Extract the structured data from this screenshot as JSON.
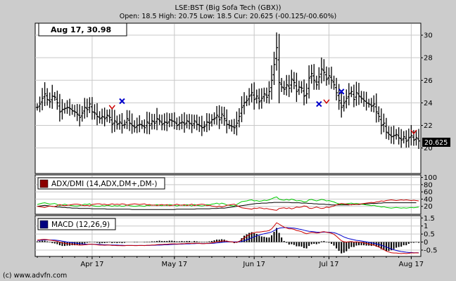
{
  "header": {
    "title": "LSE:BST (Big Sofa Tech (GBX))",
    "quote": "Open: 18.5 High: 20.75 Low: 18.5 Cur: 20.625 (-00.125/-00.60%)"
  },
  "date_box": "Aug 17, 30.98",
  "last_price_label": "20.625",
  "copyright": "(c) www.advfn.com",
  "colors": {
    "background": "#cccccc",
    "panel": "#ffffff",
    "grid": "#c8c8c8",
    "adx": "#000000",
    "dmi_plus": "#00cc00",
    "dmi_minus": "#cc0000",
    "macd": "#cc0000",
    "signal": "#0000cc",
    "histogram": "#000000",
    "price_bars": "#000000",
    "buy_marker": "#0000cc",
    "sell_marker": "#cc0000",
    "adx_legend": "#8b0000",
    "macd_legend": "#000080"
  },
  "chart_data": [
    {
      "type": "ohlc",
      "title": "LSE:BST (Big Sofa Tech (GBX))",
      "x_ticks": [
        "Apr 17",
        "May 17",
        "Jun 17",
        "Jul 17",
        "Aug 17"
      ],
      "y_ticks": [
        20,
        22,
        24,
        26,
        28,
        30
      ],
      "ylim": [
        17.8,
        31.0
      ],
      "grid": true,
      "last_price": 20.625,
      "close": [
        23.6,
        23.9,
        24.4,
        24.8,
        24.3,
        24.1,
        24.6,
        24.5,
        24.0,
        23.2,
        23.4,
        23.5,
        23.6,
        23.5,
        23.3,
        23.2,
        23.0,
        22.7,
        23.1,
        23.6,
        23.4,
        23.9,
        23.2,
        23.1,
        22.8,
        22.6,
        22.8,
        22.6,
        22.9,
        22.7,
        22.1,
        22.4,
        22.1,
        22.3,
        22.0,
        22.1,
        22.6,
        22.2,
        22.0,
        21.8,
        22.0,
        22.1,
        22.0,
        21.8,
        22.3,
        22.0,
        22.4,
        22.2,
        22.6,
        22.4,
        22.1,
        22.3,
        22.2,
        22.5,
        22.4,
        22.3,
        22.0,
        22.2,
        22.3,
        22.1,
        22.4,
        22.2,
        22.0,
        22.4,
        22.1,
        22.0,
        21.8,
        21.9,
        22.3,
        22.2,
        22.5,
        22.6,
        22.9,
        22.5,
        23.0,
        22.6,
        22.1,
        22.0,
        21.9,
        21.8,
        22.2,
        22.8,
        23.6,
        24.0,
        24.2,
        24.6,
        24.9,
        24.3,
        24.6,
        24.1,
        24.4,
        24.8,
        24.5,
        25.0,
        26.0,
        27.4,
        28.9,
        25.8,
        25.4,
        25.2,
        25.6,
        25.3,
        26.1,
        25.8,
        25.0,
        25.4,
        25.3,
        24.6,
        24.8,
        26.2,
        26.6,
        26.0,
        25.6,
        26.3,
        27.0,
        26.7,
        26.1,
        26.4,
        26.0,
        25.6,
        24.9,
        24.2,
        23.6,
        24.0,
        24.4,
        24.8,
        25.0,
        24.3,
        24.9,
        24.6,
        24.4,
        24.2,
        24.0,
        23.9,
        23.7,
        23.9,
        23.2,
        22.8,
        22.0,
        22.2,
        21.4,
        21.2,
        21.0,
        21.1,
        21.2,
        20.9,
        20.7,
        21.0,
        20.6,
        20.9,
        21.1,
        20.7,
        20.9,
        20.625
      ]
    },
    {
      "type": "line",
      "title": "ADX/DMI (14,ADX,DM+,DM-)",
      "y_ticks": [
        20,
        40,
        60,
        80,
        100
      ],
      "ylim": [
        0,
        105
      ],
      "series": [
        {
          "name": "ADX",
          "values": [
            20,
            21,
            22,
            23,
            22,
            21,
            20,
            19,
            18,
            18,
            17,
            17,
            16,
            16,
            15,
            15,
            15,
            14,
            14,
            14,
            14,
            14,
            13,
            13,
            13,
            13,
            13,
            13,
            12,
            12,
            12,
            12,
            12,
            12,
            12,
            12,
            12,
            12,
            11,
            11,
            11,
            11,
            11,
            11,
            11,
            11,
            11,
            11,
            11,
            11,
            11,
            11,
            11,
            11,
            11,
            11,
            12,
            12,
            12,
            12,
            12,
            12,
            12,
            12,
            13,
            13,
            13,
            13,
            13,
            13,
            14,
            14,
            14,
            15,
            15,
            15,
            16,
            17,
            18,
            19,
            20,
            21,
            22,
            23,
            24,
            25,
            26,
            27,
            28,
            28,
            29,
            29,
            29,
            30,
            30,
            31,
            31,
            31,
            31,
            31,
            31,
            31,
            30,
            30,
            30,
            30,
            29,
            29,
            29,
            28,
            28,
            27,
            27,
            26,
            26,
            26,
            25,
            25,
            24,
            24,
            24,
            24,
            24,
            24,
            24,
            24,
            25,
            25,
            25,
            25,
            26,
            26,
            27,
            27,
            28,
            28,
            28,
            29,
            29,
            30,
            30,
            30,
            30,
            30,
            30,
            30,
            30,
            30,
            30,
            30,
            30,
            30,
            30
          ]
        },
        {
          "name": "DM+",
          "values": [
            25,
            27,
            29,
            30,
            28,
            26,
            27,
            28,
            25,
            22,
            24,
            26,
            24,
            23,
            22,
            21,
            21,
            22,
            24,
            26,
            25,
            27,
            22,
            21,
            20,
            20,
            22,
            21,
            23,
            22,
            20,
            22,
            21,
            22,
            20,
            21,
            24,
            22,
            21,
            20,
            21,
            22,
            21,
            20,
            23,
            22,
            24,
            23,
            25,
            23,
            22,
            24,
            22,
            25,
            24,
            23,
            21,
            23,
            24,
            22,
            25,
            23,
            21,
            25,
            23,
            22,
            21,
            22,
            25,
            24,
            26,
            27,
            29,
            26,
            29,
            27,
            24,
            23,
            22,
            21,
            25,
            29,
            33,
            34,
            35,
            37,
            38,
            35,
            36,
            34,
            35,
            37,
            36,
            38,
            41,
            44,
            46,
            40,
            38,
            37,
            39,
            37,
            40,
            38,
            35,
            36,
            35,
            32,
            33,
            38,
            39,
            37,
            35,
            37,
            39,
            38,
            35,
            36,
            34,
            32,
            29,
            27,
            25,
            26,
            27,
            28,
            29,
            27,
            28,
            27,
            26,
            25,
            24,
            23,
            22,
            23,
            21,
            20,
            18,
            19,
            17,
            16,
            15,
            16,
            17,
            16,
            15,
            16,
            15,
            16,
            17,
            16,
            17,
            18
          ]
        },
        {
          "name": "DM-",
          "values": [
            20,
            19,
            18,
            17,
            19,
            21,
            20,
            19,
            22,
            25,
            23,
            22,
            23,
            24,
            25,
            26,
            26,
            25,
            23,
            22,
            23,
            21,
            25,
            26,
            27,
            27,
            25,
            26,
            24,
            25,
            27,
            25,
            26,
            25,
            27,
            26,
            23,
            25,
            26,
            27,
            26,
            25,
            26,
            27,
            24,
            25,
            23,
            24,
            22,
            24,
            25,
            23,
            25,
            22,
            23,
            24,
            26,
            24,
            23,
            25,
            22,
            24,
            26,
            22,
            24,
            25,
            26,
            25,
            22,
            23,
            21,
            20,
            18,
            21,
            18,
            20,
            23,
            24,
            25,
            26,
            22,
            19,
            16,
            15,
            14,
            13,
            12,
            15,
            14,
            16,
            15,
            13,
            14,
            12,
            11,
            10,
            9,
            14,
            15,
            16,
            14,
            16,
            13,
            15,
            18,
            17,
            18,
            21,
            20,
            15,
            14,
            16,
            18,
            16,
            14,
            15,
            18,
            17,
            19,
            21,
            24,
            26,
            28,
            27,
            26,
            25,
            24,
            26,
            25,
            26,
            27,
            28,
            29,
            30,
            31,
            30,
            32,
            33,
            35,
            34,
            36,
            37,
            38,
            37,
            36,
            37,
            38,
            37,
            38,
            37,
            36,
            37,
            36,
            35
          ]
        }
      ]
    },
    {
      "type": "line",
      "title": "MACD (12,26,9)",
      "y_ticks": [
        -0.5,
        0,
        0.5,
        1,
        1.5
      ],
      "ylim": [
        -0.85,
        1.6
      ],
      "series": [
        {
          "name": "MACD",
          "values": [
            0.12,
            0.14,
            0.16,
            0.17,
            0.15,
            0.12,
            0.1,
            0.08,
            0.05,
            0.0,
            -0.05,
            -0.08,
            -0.1,
            -0.12,
            -0.13,
            -0.15,
            -0.17,
            -0.19,
            -0.19,
            -0.17,
            -0.16,
            -0.13,
            -0.14,
            -0.15,
            -0.17,
            -0.19,
            -0.19,
            -0.2,
            -0.19,
            -0.19,
            -0.21,
            -0.21,
            -0.22,
            -0.22,
            -0.23,
            -0.23,
            -0.21,
            -0.21,
            -0.21,
            -0.22,
            -0.22,
            -0.21,
            -0.21,
            -0.22,
            -0.2,
            -0.2,
            -0.18,
            -0.18,
            -0.16,
            -0.15,
            -0.15,
            -0.14,
            -0.14,
            -0.12,
            -0.11,
            -0.11,
            -0.12,
            -0.11,
            -0.1,
            -0.1,
            -0.08,
            -0.08,
            -0.09,
            -0.07,
            -0.07,
            -0.08,
            -0.1,
            -0.1,
            -0.08,
            -0.07,
            -0.05,
            -0.02,
            0.02,
            0.03,
            0.06,
            0.07,
            0.05,
            0.03,
            0.01,
            -0.02,
            -0.01,
            0.04,
            0.15,
            0.26,
            0.36,
            0.46,
            0.55,
            0.58,
            0.62,
            0.62,
            0.64,
            0.67,
            0.68,
            0.72,
            0.82,
            1.0,
            1.2,
            1.12,
            1.02,
            0.93,
            0.88,
            0.82,
            0.82,
            0.79,
            0.72,
            0.69,
            0.65,
            0.57,
            0.52,
            0.56,
            0.6,
            0.59,
            0.56,
            0.57,
            0.63,
            0.65,
            0.61,
            0.59,
            0.55,
            0.48,
            0.36,
            0.22,
            0.08,
            0.02,
            0.0,
            0.02,
            0.04,
            0.0,
            0.01,
            0.0,
            -0.02,
            -0.05,
            -0.09,
            -0.12,
            -0.16,
            -0.18,
            -0.24,
            -0.3,
            -0.4,
            -0.47,
            -0.56,
            -0.62,
            -0.66,
            -0.68,
            -0.68,
            -0.7,
            -0.72,
            -0.7,
            -0.72,
            -0.7,
            -0.67,
            -0.68,
            -0.67,
            -0.68
          ]
        },
        {
          "name": "Signal",
          "values": [
            0.1,
            0.11,
            0.12,
            0.13,
            0.13,
            0.13,
            0.13,
            0.12,
            0.11,
            0.09,
            0.06,
            0.03,
            0.0,
            -0.02,
            -0.04,
            -0.06,
            -0.08,
            -0.1,
            -0.12,
            -0.13,
            -0.14,
            -0.14,
            -0.14,
            -0.14,
            -0.15,
            -0.15,
            -0.16,
            -0.17,
            -0.17,
            -0.18,
            -0.18,
            -0.19,
            -0.19,
            -0.2,
            -0.2,
            -0.21,
            -0.21,
            -0.21,
            -0.21,
            -0.21,
            -0.21,
            -0.21,
            -0.21,
            -0.21,
            -0.21,
            -0.21,
            -0.2,
            -0.2,
            -0.19,
            -0.19,
            -0.18,
            -0.17,
            -0.17,
            -0.16,
            -0.15,
            -0.14,
            -0.14,
            -0.13,
            -0.13,
            -0.12,
            -0.11,
            -0.11,
            -0.1,
            -0.1,
            -0.09,
            -0.09,
            -0.09,
            -0.09,
            -0.09,
            -0.09,
            -0.08,
            -0.07,
            -0.05,
            -0.04,
            -0.02,
            0.0,
            0.01,
            0.01,
            0.01,
            0.01,
            0.01,
            0.01,
            0.04,
            0.08,
            0.14,
            0.2,
            0.27,
            0.33,
            0.39,
            0.44,
            0.48,
            0.52,
            0.55,
            0.59,
            0.63,
            0.71,
            0.8,
            0.86,
            0.89,
            0.9,
            0.9,
            0.89,
            0.88,
            0.87,
            0.84,
            0.81,
            0.78,
            0.74,
            0.7,
            0.67,
            0.66,
            0.64,
            0.62,
            0.61,
            0.61,
            0.62,
            0.62,
            0.61,
            0.6,
            0.58,
            0.54,
            0.47,
            0.4,
            0.32,
            0.26,
            0.21,
            0.18,
            0.14,
            0.11,
            0.09,
            0.07,
            0.04,
            0.01,
            -0.02,
            -0.05,
            -0.08,
            -0.11,
            -0.15,
            -0.2,
            -0.25,
            -0.31,
            -0.37,
            -0.43,
            -0.48,
            -0.52,
            -0.56,
            -0.59,
            -0.61,
            -0.63,
            -0.65,
            -0.65,
            -0.66,
            -0.66,
            -0.66
          ]
        }
      ]
    }
  ],
  "markers": [
    {
      "type": "buy",
      "x_index": 34,
      "price": 24.15
    },
    {
      "type": "sell",
      "x_index": 30,
      "price": 23.6
    },
    {
      "type": "buy",
      "x_index": 113,
      "price": 23.9
    },
    {
      "type": "sell",
      "x_index": 116,
      "price": 24.1
    },
    {
      "type": "buy",
      "x_index": 122,
      "price": 25.0
    },
    {
      "type": "sell",
      "x_index": 151,
      "price": 21.4
    }
  ]
}
